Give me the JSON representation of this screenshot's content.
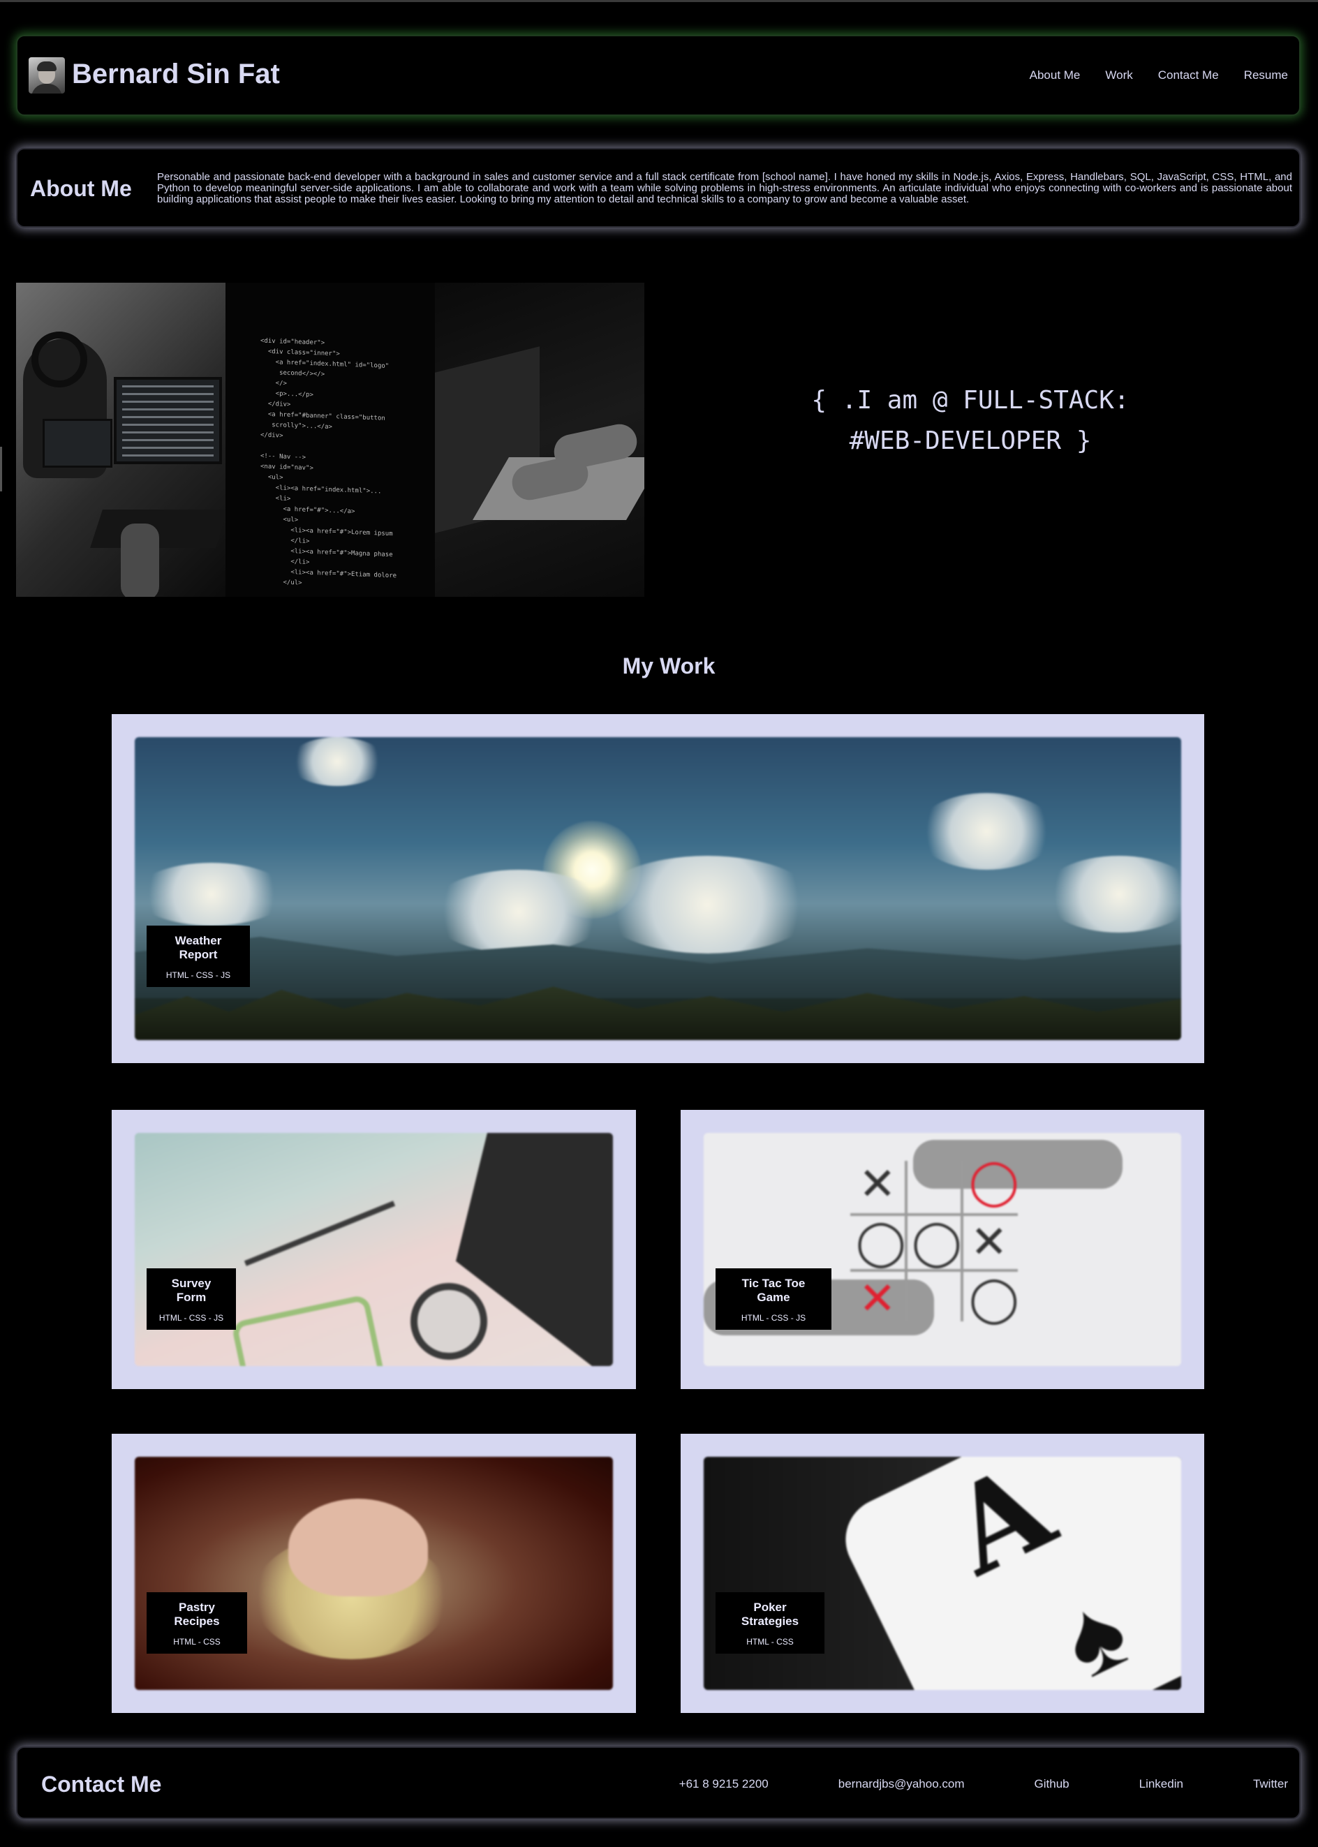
{
  "header": {
    "name": "Bernard Sin Fat",
    "nav": [
      "About Me",
      "Work",
      "Contact Me",
      "Resume"
    ]
  },
  "about": {
    "title": "About Me",
    "text": "Personable and passionate back-end developer with a background in sales and customer service and a full stack certificate from [school name]. I have honed my skills in Node.js, Axios, Express, Handlebars, SQL, JavaScript, CSS, HTML, and Python to develop meaningful server-side applications. I am able to collaborate and work with a team while solving problems in high-stress environments. An articulate individual who enjoys connecting with co-workers and is passionate about building applications that assist people to make their lives easier. Looking to bring my attention to detail and technical skills to a company to grow and become a valuable asset."
  },
  "hero": {
    "line1": "{ .I am @ FULL-STACK:",
    "line2": "#WEB-DEVELOPER }"
  },
  "work": {
    "title": "My Work",
    "projects": [
      {
        "name": "Weather Report",
        "tech": "HTML - CSS - JS"
      },
      {
        "name": "Survey Form",
        "tech": "HTML - CSS - JS"
      },
      {
        "name": "Tic Tac Toe Game",
        "tech": "HTML - CSS - JS"
      },
      {
        "name": "Pastry Recipes",
        "tech": "HTML - CSS"
      },
      {
        "name": "Poker Strategies",
        "tech": "HTML - CSS"
      }
    ]
  },
  "contact": {
    "title": "Contact Me",
    "phone": "+61 8 9215 2200",
    "email": "bernardjbs@yahoo.com",
    "github": "Github",
    "linkedin": "Linkedin",
    "twitter": "Twitter"
  },
  "colors": {
    "background": "#000000",
    "text": "#d8d9f2",
    "card_frame": "#d6d7f1",
    "header_glow": "#50c850"
  },
  "icons": {
    "avatar": "profile-photo"
  }
}
